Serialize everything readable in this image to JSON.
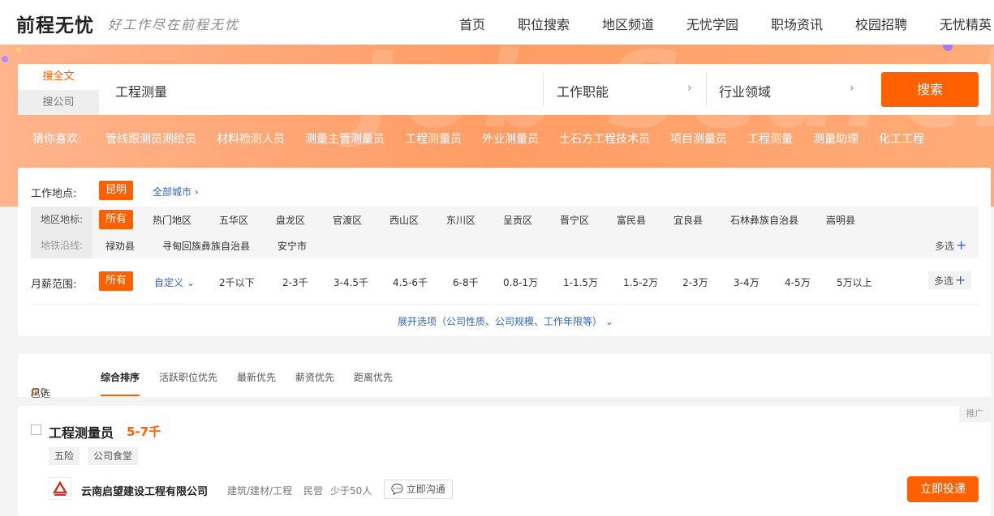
{
  "header": {
    "logo": "前程无忧",
    "slogan": "好工作尽在前程无忧",
    "nav": [
      "首页",
      "职位搜索",
      "地区频道",
      "无忧学园",
      "职场资讯",
      "校园招聘",
      "无忧精英"
    ]
  },
  "band": {
    "watermark": "Job Search"
  },
  "search": {
    "tab_fulltext": "搜全文",
    "tab_company": "搜公司",
    "keyword": "工程测量",
    "function_label": "工作职能",
    "industry_label": "行业领域",
    "button": "搜索"
  },
  "guess": {
    "label": "猜你喜欢:",
    "items": [
      "管线跟测员测绘员",
      "材料检测人员",
      "测量主管测量员",
      "工程测量员",
      "外业测量员",
      "土石方工程技术员",
      "项目测量员",
      "工程测量",
      "测量助理",
      "化工工程"
    ]
  },
  "filter": {
    "location_label": "工作地点:",
    "city": "昆明",
    "all_cities": "全部城市",
    "area_label": "地区地标:",
    "metro_label": "地铁沿线:",
    "area_all": "所有",
    "areas": [
      "热门地区",
      "五华区",
      "盘龙区",
      "官渡区",
      "西山区",
      "东川区",
      "呈贡区",
      "晋宁区",
      "富民县",
      "宜良县",
      "石林彝族自治县",
      "嵩明县"
    ],
    "areas_row2": [
      "禄劝县",
      "寻甸回族彝族自治县",
      "安宁市"
    ],
    "multi": "多选",
    "salary_label": "月薪范围:",
    "salary_all": "所有",
    "salary_custom": "自定义",
    "salaries": [
      "2千以下",
      "2-3千",
      "3-4.5千",
      "4.5-6千",
      "6-8千",
      "0.8-1万",
      "1-1.5万",
      "1.5-2万",
      "2-3万",
      "3-4万",
      "4-5万",
      "5万以上"
    ],
    "expand": "展开选项（公司性质、公司规模、工作年限等）"
  },
  "sort": {
    "selected_label": "已选",
    "selected_count": "0",
    "selected_total": "/20",
    "options": [
      "综合排序",
      "活跃职位优先",
      "最新优先",
      "薪资优先",
      "距离优先"
    ]
  },
  "job": {
    "title": "工程测量员",
    "salary": "5-7千",
    "promo": "推广",
    "tags": [
      "五险",
      "公司食堂"
    ],
    "company": "云南启望建设工程有限公司",
    "industry": "建筑/建材/工程",
    "ownership": "民营",
    "size": "少于50人",
    "chat": "立即沟通",
    "apply": "立即投递"
  },
  "colors": {
    "accent": "#ff6000",
    "link": "#3363b5"
  }
}
